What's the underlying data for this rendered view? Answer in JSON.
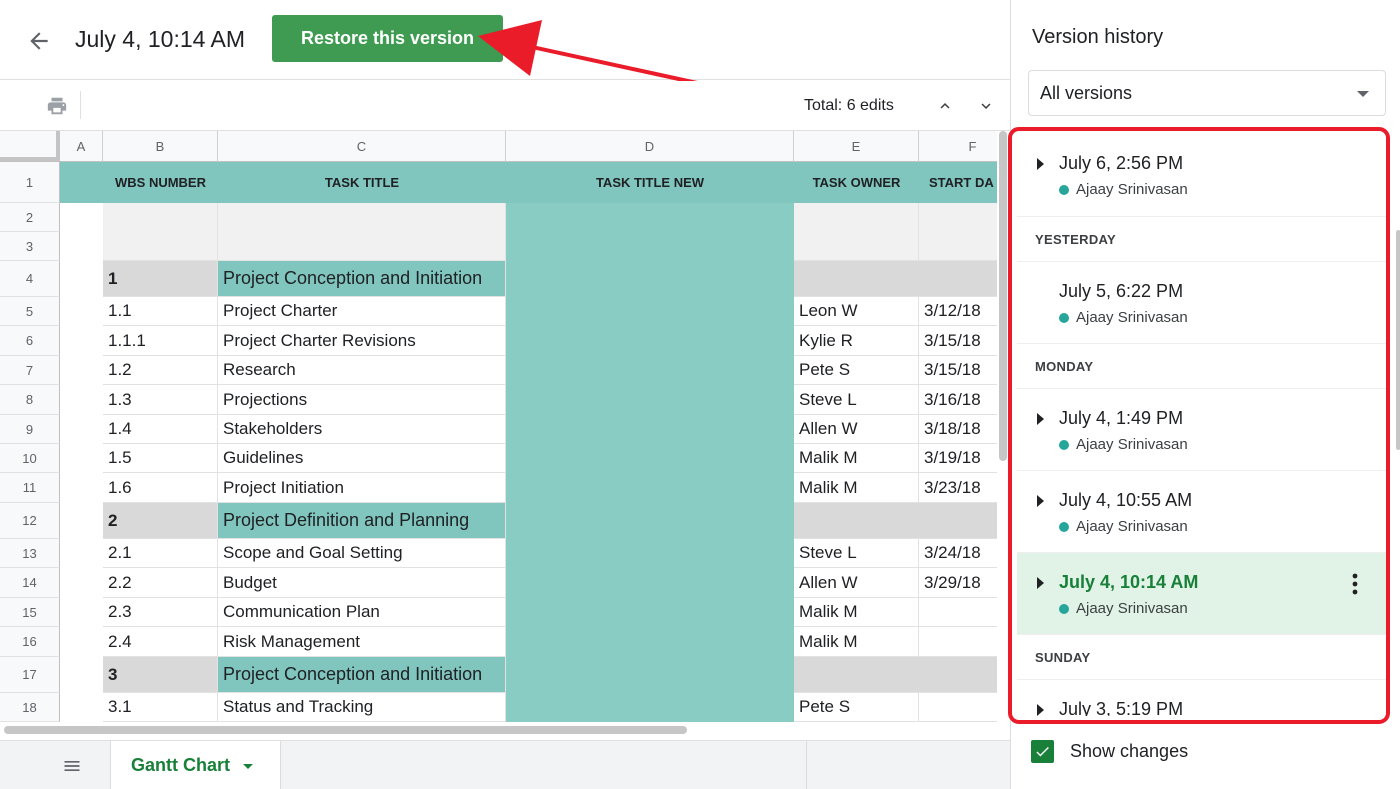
{
  "header": {
    "title": "July 4, 10:14 AM",
    "restore_label": "Restore this version"
  },
  "toolbar": {
    "total_edits": "Total: 6 edits"
  },
  "colors": {
    "accent": "#3e9b51",
    "header_teal": "#80c6be",
    "selected_bg": "#e1f2e7",
    "annotation_red": "#ea1c2a"
  },
  "sheet": {
    "columns": [
      "A",
      "B",
      "C",
      "D",
      "E",
      "F"
    ],
    "row_numbers": [
      "1",
      "2",
      "3",
      "4",
      "5",
      "6",
      "7",
      "8",
      "9",
      "10",
      "11",
      "12",
      "13",
      "14",
      "15",
      "16",
      "17",
      "18"
    ],
    "headers": {
      "wbs": "WBS NUMBER",
      "task": "TASK TITLE",
      "task_new": "TASK TITLE NEW",
      "owner": "TASK OWNER",
      "start": "START DA"
    },
    "rows": [
      {
        "wbs": "1",
        "task": "Project Conception and Initiation",
        "owner": "",
        "start": ""
      },
      {
        "wbs": "1.1",
        "task": "Project Charter",
        "owner": "Leon W",
        "start": "3/12/18"
      },
      {
        "wbs": "1.1.1",
        "task": "Project Charter Revisions",
        "owner": "Kylie R",
        "start": "3/15/18"
      },
      {
        "wbs": "1.2",
        "task": "Research",
        "owner": "Pete S",
        "start": "3/15/18"
      },
      {
        "wbs": "1.3",
        "task": "Projections",
        "owner": "Steve L",
        "start": "3/16/18"
      },
      {
        "wbs": "1.4",
        "task": "Stakeholders",
        "owner": "Allen W",
        "start": "3/18/18"
      },
      {
        "wbs": "1.5",
        "task": "Guidelines",
        "owner": "Malik M",
        "start": "3/19/18"
      },
      {
        "wbs": "1.6",
        "task": "Project Initiation",
        "owner": "Malik M",
        "start": "3/23/18"
      },
      {
        "wbs": "2",
        "task": "Project Definition and Planning",
        "owner": "",
        "start": ""
      },
      {
        "wbs": "2.1",
        "task": "Scope and Goal Setting",
        "owner": "Steve L",
        "start": "3/24/18"
      },
      {
        "wbs": "2.2",
        "task": "Budget",
        "owner": "Allen W",
        "start": "3/29/18"
      },
      {
        "wbs": "2.3",
        "task": "Communication Plan",
        "owner": "Malik M",
        "start": ""
      },
      {
        "wbs": "2.4",
        "task": "Risk Management",
        "owner": "Malik M",
        "start": ""
      },
      {
        "wbs": "3",
        "task": "Project Conception and Initiation",
        "owner": "",
        "start": ""
      },
      {
        "wbs": "3.1",
        "task": "Status and Tracking",
        "owner": "Pete S",
        "start": ""
      }
    ],
    "tab_label": "Gantt Chart"
  },
  "panel": {
    "title": "Version history",
    "filter_value": "All versions",
    "groups": {
      "yesterday": "YESTERDAY",
      "monday": "MONDAY",
      "sunday": "SUNDAY"
    },
    "versions": [
      {
        "time": "July 6, 2:56 PM",
        "author": "Ajaay Srinivasan"
      },
      {
        "time": "July 5, 6:22 PM",
        "author": "Ajaay Srinivasan"
      },
      {
        "time": "July 4, 1:49 PM",
        "author": "Ajaay Srinivasan"
      },
      {
        "time": "July 4, 10:55 AM",
        "author": "Ajaay Srinivasan"
      },
      {
        "time": "July 4, 10:14 AM",
        "author": "Ajaay Srinivasan"
      },
      {
        "time": "July 3, 5:19 PM",
        "author": ""
      }
    ],
    "show_changes": "Show changes"
  },
  "icons": {
    "back": "arrow-left-icon",
    "print": "print-icon",
    "up": "chevron-up-icon",
    "down": "chevron-down-icon",
    "sheets": "menu-lines-icon",
    "more": "more-vertical-icon",
    "check": "check-icon"
  }
}
